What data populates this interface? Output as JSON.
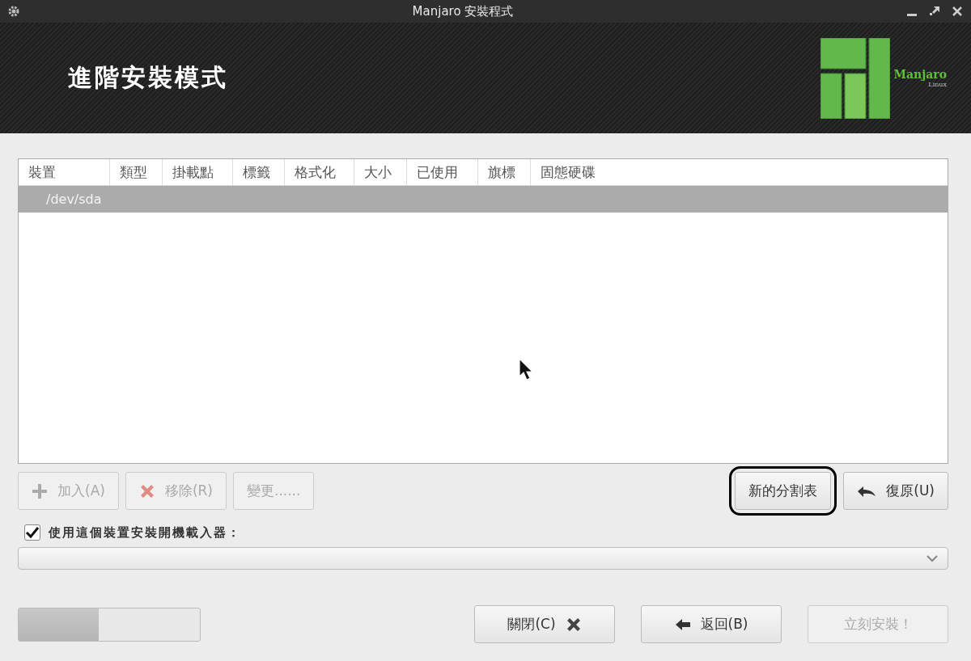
{
  "window": {
    "title": "Manjaro 安裝程式"
  },
  "header": {
    "title": "進階安裝模式",
    "logo_text": "Manjaro",
    "logo_subtext": "Linux"
  },
  "table": {
    "columns": [
      "裝置",
      "類型",
      "掛載點",
      "標籤",
      "格式化",
      "大小",
      "已使用",
      "旗標",
      "固態硬碟"
    ],
    "rows": [
      {
        "device": "/dev/sda",
        "selected": true
      }
    ]
  },
  "partition_buttons": [
    {
      "label": "加入(A)",
      "kind": "plus",
      "disabled": true
    },
    {
      "label": "移除(R)",
      "kind": "cross",
      "disabled": true
    },
    {
      "label": "變更......",
      "kind": "plain",
      "disabled": true
    }
  ],
  "table_buttons": [
    {
      "label": "新的分割表",
      "kind": "plain",
      "disabled": false,
      "highlighted": true
    },
    {
      "label": "復原(U)",
      "kind": "undo",
      "disabled": false,
      "highlighted": false
    }
  ],
  "bootloader": {
    "label": "使用這個裝置安裝開機載入器：",
    "checked": true
  },
  "progress": {
    "level": 0.44
  },
  "nav_buttons": [
    {
      "label": "關閉(C)",
      "kind": "cross-after",
      "disabled": false
    },
    {
      "label": "返回(B)",
      "kind": "back",
      "disabled": false
    },
    {
      "label": "立刻安裝！",
      "kind": "plain",
      "disabled": true
    }
  ]
}
